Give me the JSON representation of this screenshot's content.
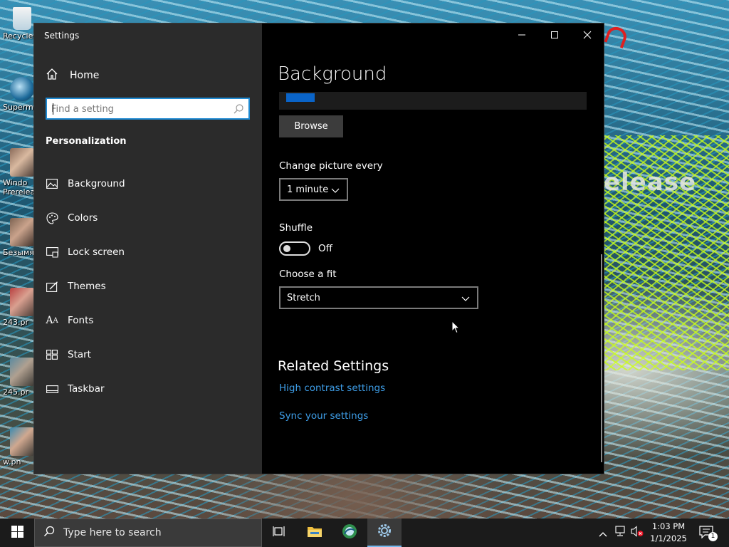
{
  "desktop": {
    "wallpaper_text": "elease",
    "icons": [
      {
        "label": "Recycle",
        "icon": "recycle-bin-icon"
      },
      {
        "label": "Superm",
        "icon": "app-icon"
      },
      {
        "label": "Windo\nPrerelea",
        "icon": "image-file-icon"
      },
      {
        "label": "Безымя",
        "icon": "image-file-icon"
      },
      {
        "label": "243.pr",
        "icon": "image-file-icon"
      },
      {
        "label": "245.pr",
        "icon": "image-file-icon"
      },
      {
        "label": "w.pn",
        "icon": "image-file-icon"
      }
    ]
  },
  "window": {
    "title": "Settings",
    "controls": {
      "minimize": "minimize-icon",
      "maximize": "maximize-icon",
      "close": "close-icon"
    }
  },
  "sidebar": {
    "home_label": "Home",
    "search": {
      "placeholder": "Find a setting",
      "value": ""
    },
    "section_title": "Personalization",
    "items": [
      {
        "label": "Background",
        "icon": "picture-icon"
      },
      {
        "label": "Colors",
        "icon": "palette-icon"
      },
      {
        "label": "Lock screen",
        "icon": "lock-screen-icon"
      },
      {
        "label": "Themes",
        "icon": "themes-icon"
      },
      {
        "label": "Fonts",
        "icon": "fonts-icon"
      },
      {
        "label": "Start",
        "icon": "start-icon"
      },
      {
        "label": "Taskbar",
        "icon": "taskbar-icon"
      }
    ]
  },
  "main": {
    "page_title": "Background",
    "browse_label": "Browse",
    "change_picture_label": "Change picture every",
    "change_picture_value": "1 minute",
    "shuffle_label": "Shuffle",
    "shuffle_state": "Off",
    "fit_label": "Choose a fit",
    "fit_value": "Stretch",
    "related_title": "Related Settings",
    "links": [
      "High contrast settings",
      "Sync your settings"
    ]
  },
  "taskbar": {
    "search_placeholder": "Type here to search",
    "apps": [
      "task-view-icon",
      "file-explorer-icon",
      "browser-icon",
      "settings-icon"
    ],
    "clock_time": "1:03 PM",
    "clock_date": "1/1/2025",
    "notification_count": "1"
  },
  "colors": {
    "accent": "#0078d7",
    "link": "#3e9ee8",
    "sidebar_bg": "#2b2b2b",
    "content_bg": "#000000",
    "taskbar_bg": "#1b1b1b"
  }
}
